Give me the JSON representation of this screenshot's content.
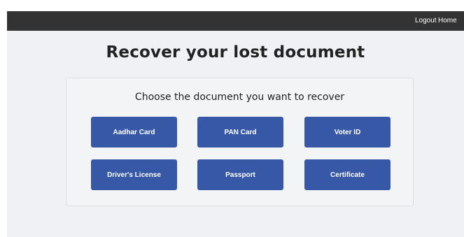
{
  "navbar": {
    "logout_label": "Logout",
    "home_label": "Home"
  },
  "main": {
    "title": "Recover your lost document",
    "subtitle": "Choose the document you want to recover",
    "documents": [
      {
        "label": "Aadhar Card"
      },
      {
        "label": "PAN Card"
      },
      {
        "label": "Voter ID"
      },
      {
        "label": "Driver's License"
      },
      {
        "label": "Passport"
      },
      {
        "label": "Certificate"
      }
    ]
  },
  "colors": {
    "navbar_bg": "#333333",
    "page_bg": "#f0f1f4",
    "button_bg": "#3758a6",
    "button_text": "#ffffff"
  }
}
